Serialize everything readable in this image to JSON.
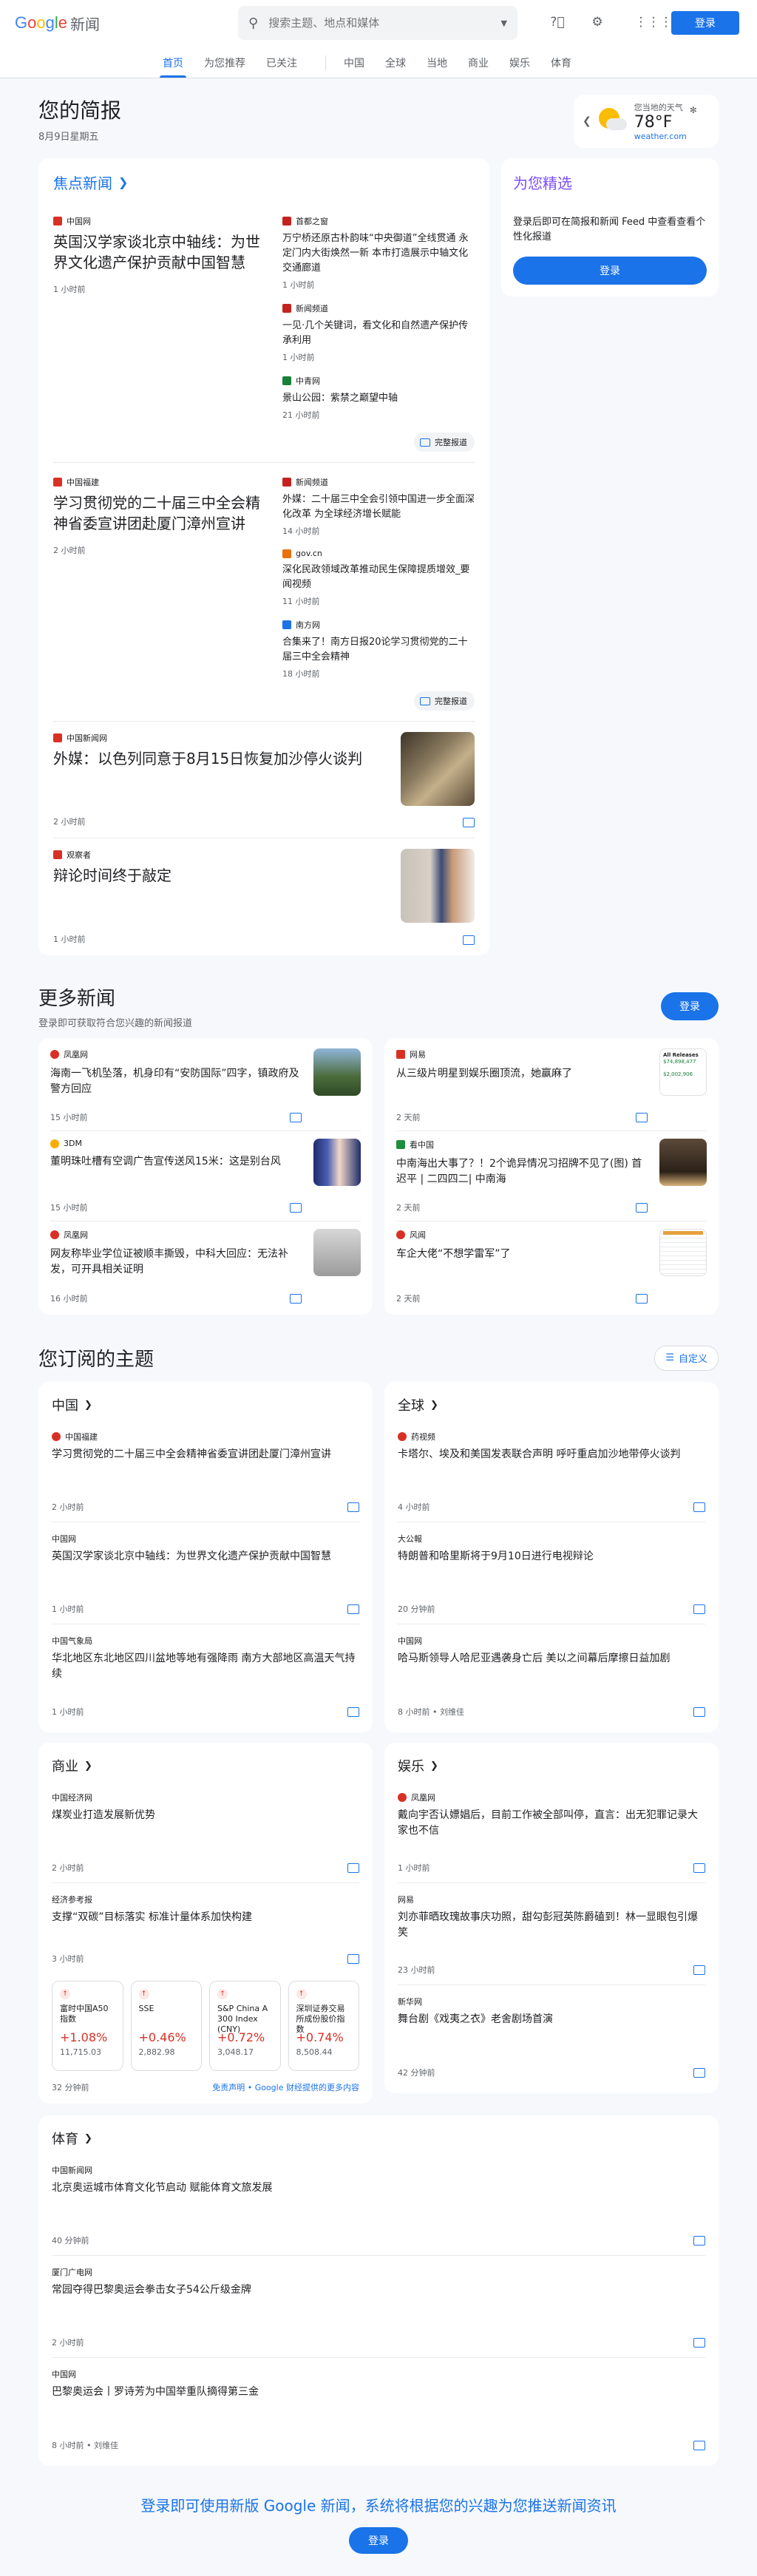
{
  "header": {
    "logo_google": "Google",
    "logo_cn": "新闻",
    "search_placeholder": "搜索主题、地点和媒体",
    "signin": "登录"
  },
  "nav": {
    "tabs": [
      "首页",
      "为您推荐",
      "已关注"
    ],
    "sections": [
      "中国",
      "全球",
      "当地",
      "商业",
      "娱乐",
      "体育"
    ]
  },
  "briefing": {
    "title": "您的简报",
    "date": "8月9日星期五"
  },
  "weather": {
    "label": "您当地的天气",
    "temp": "78°F",
    "source": "weather.com"
  },
  "top_news": {
    "title": "焦点新闻",
    "clusters": [
      {
        "main": {
          "source": "中国网",
          "headline": "英国汉学家谈北京中轴线：为世界文化遗产保护贡献中国智慧",
          "time": "1 小时前"
        },
        "side": [
          {
            "source": "首都之窗",
            "headline": "万宁桥还原古朴韵味“中央御道”全线贯通 永定门内大街焕然一新 本市打造展示中轴文化交通廊道",
            "time": "1 小时前"
          },
          {
            "source": "新闻频道",
            "headline": "一见·几个关键词，看文化和自然遗产保护传承利用",
            "time": "1 小时前"
          },
          {
            "source": "中青网",
            "headline": "景山公园：紫禁之巅望中轴",
            "time": "21 小时前"
          }
        ],
        "full": "完整报道"
      },
      {
        "main": {
          "source": "中国福建",
          "headline": "学习贯彻党的二十届三中全会精神省委宣讲团赴厦门漳州宣讲",
          "time": "2 小时前"
        },
        "side": [
          {
            "source": "新闻频道",
            "headline": "外媒：二十届三中全会引领中国进一步全面深化改革 为全球经济增长赋能",
            "time": "14 小时前"
          },
          {
            "source": "gov.cn",
            "headline": "深化民政领域改革推动民生保障提质增效_要闻视频",
            "time": "11 小时前"
          },
          {
            "source": "南方网",
            "headline": "合集来了！南方日报20论学习贯彻党的二十届三中全会精神",
            "time": "18 小时前"
          }
        ],
        "full": "完整报道"
      }
    ],
    "image_rows": [
      {
        "source": "中国新闻网",
        "headline": "外媒：以色列同意于8月15日恢复加沙停火谈判",
        "time": "2 小时前"
      },
      {
        "source": "观察者",
        "headline": "辩论时间终于敲定",
        "time": "1 小时前"
      }
    ]
  },
  "picks": {
    "title": "为您精选",
    "text": "登录后即可在简报和新闻 Feed 中查看查看个性化报道",
    "button": "登录"
  },
  "more_news": {
    "title": "更多新闻",
    "subtitle": "登录即可获取符合您兴趣的新闻报道",
    "button": "登录",
    "left": [
      {
        "source": "凤凰网",
        "headline": "海南一飞机坠落，机身印有“安防国际”四字，镇政府及警方回应",
        "time": "15 小时前"
      },
      {
        "source": "3DM",
        "headline": "董明珠吐槽有空调广告宣传送风15米：这是别台风",
        "time": "15 小时前"
      },
      {
        "source": "凤凰网",
        "headline": "网友称毕业学位证被顺丰撕毁，中科大回应：无法补发，可开具相关证明",
        "time": "16 小时前"
      }
    ],
    "right": [
      {
        "source": "网易",
        "headline": "从三级片明星到娱乐圈顶流，她赢麻了",
        "time": "2 天前"
      },
      {
        "source": "看中国",
        "headline": "中南海出大事了？！2个诡异情况习招牌不见了(图) 首迟平 | 二四四二| 中南海",
        "time": "2 天前"
      },
      {
        "source": "风闻",
        "headline": "车企大佬“不想学雷军”了",
        "time": "2 天前"
      }
    ],
    "thumb_text": [
      "All Releases",
      "$74,898,477",
      "$2,002,906"
    ]
  },
  "topics": {
    "title": "您订阅的主题",
    "custom": "自定义",
    "china": {
      "title": "中国",
      "items": [
        {
          "source": "中国福建",
          "headline": "学习贯彻党的二十届三中全会精神省委宣讲团赴厦门漳州宣讲",
          "time": "2 小时前"
        },
        {
          "source": "中国网",
          "headline": "英国汉学家谈北京中轴线：为世界文化遗产保护贡献中国智慧",
          "time": "1 小时前"
        },
        {
          "source": "中国气象局",
          "headline": "华北地区东北地区四川盆地等地有强降雨 南方大部地区高温天气持续",
          "time": "1 小时前"
        }
      ]
    },
    "world": {
      "title": "全球",
      "items": [
        {
          "source": "药视频",
          "headline": "卡塔尔、埃及和美国发表联合声明 呼吁重启加沙地带停火谈判",
          "time": "4 小时前"
        },
        {
          "source": "大公報",
          "headline": "特朗普和哈里斯将于9月10日进行电视辩论",
          "time": "20 分钟前"
        },
        {
          "source": "中国网",
          "headline": "哈马斯领导人哈尼亚遇袭身亡后 美以之间幕后摩擦日益加剧",
          "time": "8 小时前 • 刘维佳"
        }
      ]
    },
    "business": {
      "title": "商业",
      "items": [
        {
          "source": "中国经济网",
          "headline": "煤炭业打造发展新优势",
          "time": "2 小时前"
        },
        {
          "source": "经济参考报",
          "headline": "支撑“双碳”目标落实 标准计量体系加快构建",
          "time": "3 小时前"
        }
      ],
      "stocks": [
        {
          "name": "富时中国A50指数",
          "pct": "+1.08%",
          "val": "11,715.03"
        },
        {
          "name": "SSE",
          "pct": "+0.46%",
          "val": "2,882.98"
        },
        {
          "name": "S&P China A 300 Index (CNY)",
          "pct": "+0.72%",
          "val": "3,048.17"
        },
        {
          "name": "深圳证券交易所成份股价指数",
          "pct": "+0.74%",
          "val": "8,508.44"
        }
      ],
      "stock_time": "32 分钟前",
      "disclaimer": "免责声明 • Google 财经提供的更多内容"
    },
    "entertainment": {
      "title": "娱乐",
      "items": [
        {
          "source": "凤凰网",
          "headline": "戴向宇否认嫖娼后，目前工作被全部叫停，直言：出无犯罪记录大家也不信",
          "time": "1 小时前"
        },
        {
          "source": "网易",
          "headline": "刘亦菲晒玫瑰故事庆功照，甜勾彭冠英陈爵磕到！林一显眼包引爆笑",
          "time": "23 小时前"
        },
        {
          "source": "新华网",
          "headline": "舞台剧《戏夷之衣》老舍剧场首演",
          "time": "42 分钟前"
        }
      ]
    },
    "sports": {
      "title": "体育",
      "items": [
        {
          "source": "中国新闻网",
          "headline": "北京奥运城市体育文化节启动 赋能体育文旅发展",
          "time": "40 分钟前"
        },
        {
          "source": "厦门广电网",
          "headline": "常园夺得巴黎奥运会拳击女子54公斤级金牌",
          "time": "2 小时前"
        },
        {
          "source": "中国网",
          "headline": "巴黎奥运会丨罗诗芳为中国举重队摘得第三金",
          "time": "8 小时前 • 刘维佳"
        }
      ]
    }
  },
  "cta": {
    "text": "登录即可使用新版 Google 新闻，系统将根据您的兴趣为您推送新闻资讯",
    "button": "登录"
  },
  "colors": {
    "accent": "#1a73e8",
    "picks": "#7c4dff",
    "up": "#d93025",
    "bg": "#f6f8fc"
  }
}
